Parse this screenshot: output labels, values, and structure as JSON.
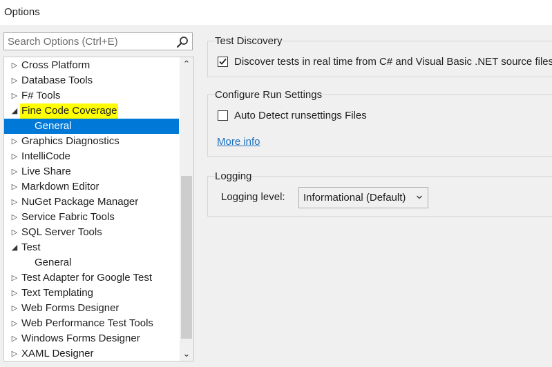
{
  "window": {
    "title": "Options"
  },
  "search": {
    "placeholder": "Search Options (Ctrl+E)",
    "value": ""
  },
  "tree": {
    "items": [
      {
        "label": "Cross Platform",
        "expanded": false
      },
      {
        "label": "Database Tools",
        "expanded": false
      },
      {
        "label": "F# Tools",
        "expanded": false
      },
      {
        "label": "Fine Code Coverage",
        "expanded": true,
        "highlighted": true
      },
      {
        "label": "General",
        "child": true,
        "selected": true
      },
      {
        "label": "Graphics Diagnostics",
        "expanded": false
      },
      {
        "label": "IntelliCode",
        "expanded": false
      },
      {
        "label": "Live Share",
        "expanded": false
      },
      {
        "label": "Markdown Editor",
        "expanded": false
      },
      {
        "label": "NuGet Package Manager",
        "expanded": false
      },
      {
        "label": "Service Fabric Tools",
        "expanded": false
      },
      {
        "label": "SQL Server Tools",
        "expanded": false
      },
      {
        "label": "Test",
        "expanded": true
      },
      {
        "label": "General",
        "child": true
      },
      {
        "label": "Test Adapter for Google Test",
        "expanded": false
      },
      {
        "label": "Text Templating",
        "expanded": false
      },
      {
        "label": "Web Forms Designer",
        "expanded": false
      },
      {
        "label": "Web Performance Test Tools",
        "expanded": false
      },
      {
        "label": "Windows Forms Designer",
        "expanded": false
      },
      {
        "label": "XAML Designer",
        "expanded": false
      }
    ]
  },
  "test_discovery": {
    "title": "Test Discovery",
    "checkbox_label": "Discover tests in real time from C# and Visual Basic .NET source files",
    "checked": true
  },
  "run_settings": {
    "title": "Configure Run Settings",
    "checkbox_label": "Auto Detect runsettings Files",
    "checked": false,
    "link": "More info"
  },
  "logging": {
    "title": "Logging",
    "level_label": "Logging level:",
    "level_value": "Informational (Default)"
  },
  "colors": {
    "selection": "#0078d7",
    "highlight": "#ffff00",
    "link": "#1a6fbf"
  }
}
